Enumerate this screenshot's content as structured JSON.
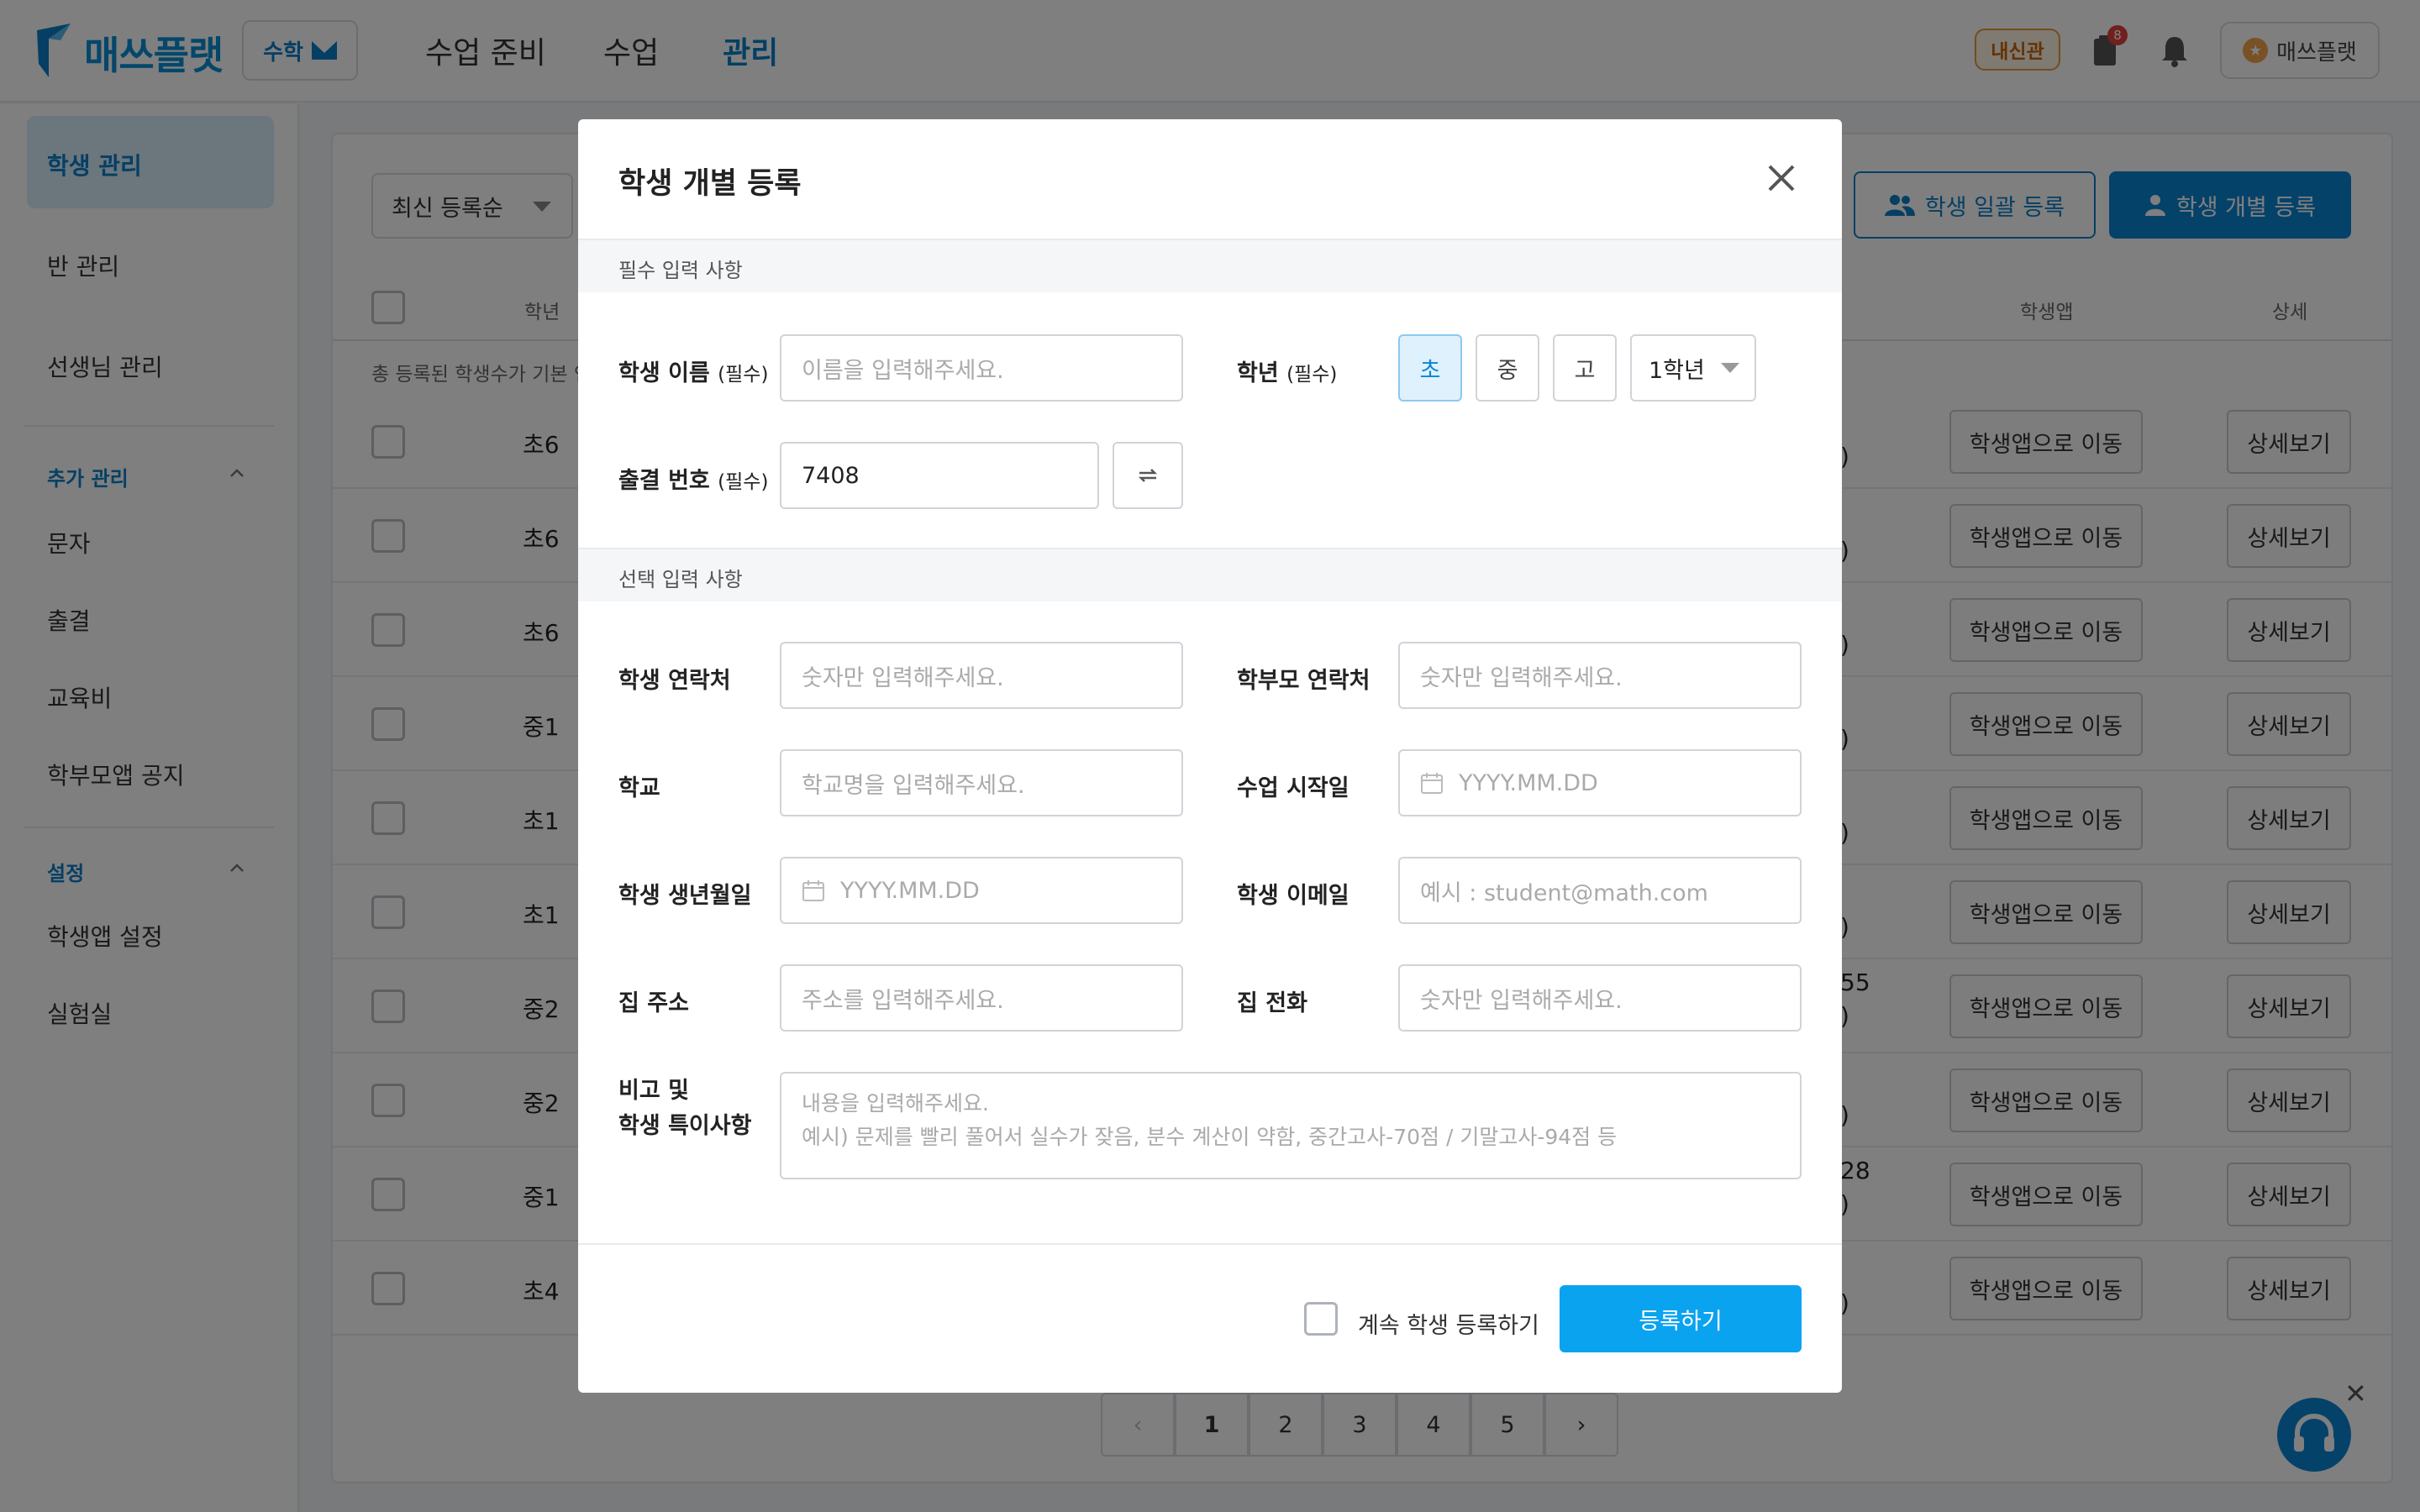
{
  "header": {
    "brand": "매쓰플랫",
    "subject": "수학",
    "nav": [
      "수업 준비",
      "수업",
      "관리"
    ],
    "active_nav": "관리",
    "badge_label": "내신관",
    "notif_count": "8",
    "user_label": "매쓰플랫"
  },
  "sidebar": {
    "items_top": [
      "학생 관리",
      "반 관리",
      "선생님 관리"
    ],
    "section_extra": "추가 관리",
    "items_extra": [
      "문자",
      "출결",
      "교육비",
      "학부모앱 공지"
    ],
    "section_settings": "설정",
    "items_settings": [
      "학생앱 설정",
      "실험실"
    ]
  },
  "content": {
    "sort_label": "최신 등록순",
    "bulk_button": "학생 일괄 등록",
    "single_button": "학생 개별 등록",
    "col_grade": "학년",
    "col_app": "학생앱",
    "col_detail": "상세",
    "note": "총 등록된 학생수가 기본 인",
    "rows": [
      {
        "grade": "초6",
        "frag": ")"
      },
      {
        "grade": "초6",
        "frag": ")"
      },
      {
        "grade": "초6",
        "frag": ")"
      },
      {
        "grade": "중1",
        "frag": ")"
      },
      {
        "grade": "초1",
        "frag": ")"
      },
      {
        "grade": "초1",
        "frag": ")"
      },
      {
        "grade": "중2",
        "frag": "55\n)"
      },
      {
        "grade": "중2",
        "frag": ")"
      },
      {
        "grade": "중1",
        "frag": "28\n)"
      },
      {
        "grade": "초4",
        "frag": ")"
      }
    ],
    "row_app_button": "학생앱으로 이동",
    "row_detail_button": "상세보기",
    "pages": [
      "1",
      "2",
      "3",
      "4",
      "5"
    ],
    "current_page": "1"
  },
  "modal": {
    "title": "학생 개별 등록",
    "required_section": "필수 입력 사항",
    "optional_section": "선택 입력 사항",
    "name_label": "학생 이름",
    "req_tag": "(필수)",
    "name_placeholder": "이름을 입력해주세요.",
    "grade_label": "학년",
    "grade_levels": [
      "초",
      "중",
      "고"
    ],
    "grade_selected": "초",
    "grade_year": "1학년",
    "attendance_label": "출결 번호",
    "attendance_value": "7408",
    "student_phone_label": "학생 연락처",
    "student_phone_placeholder": "숫자만 입력해주세요.",
    "parent_phone_label": "학부모 연락처",
    "parent_phone_placeholder": "숫자만 입력해주세요.",
    "school_label": "학교",
    "school_placeholder": "학교명을 입력해주세요.",
    "start_label": "수업 시작일",
    "date_placeholder": "YYYY.MM.DD",
    "birth_label": "학생 생년월일",
    "email_label": "학생 이메일",
    "email_placeholder": "예시 : student@math.com",
    "address_label": "집 주소",
    "address_placeholder": "주소를 입력해주세요.",
    "home_phone_label": "집 전화",
    "home_phone_placeholder": "숫자만 입력해주세요.",
    "memo_label_1": "비고 및",
    "memo_label_2": "학생 특이사항",
    "memo_placeholder_1": "내용을 입력해주세요.",
    "memo_placeholder_2": "예시) 문제를 빨리 풀어서 실수가 잦음, 분수 계산이 약함, 중간고사-70점 / 기말고사-94점 등",
    "continue_label": "계속 학생 등록하기",
    "submit_label": "등록하기"
  },
  "colors": {
    "primary": "#0a85d4",
    "submit": "#0aa3f0",
    "badge": "#c9650b"
  }
}
